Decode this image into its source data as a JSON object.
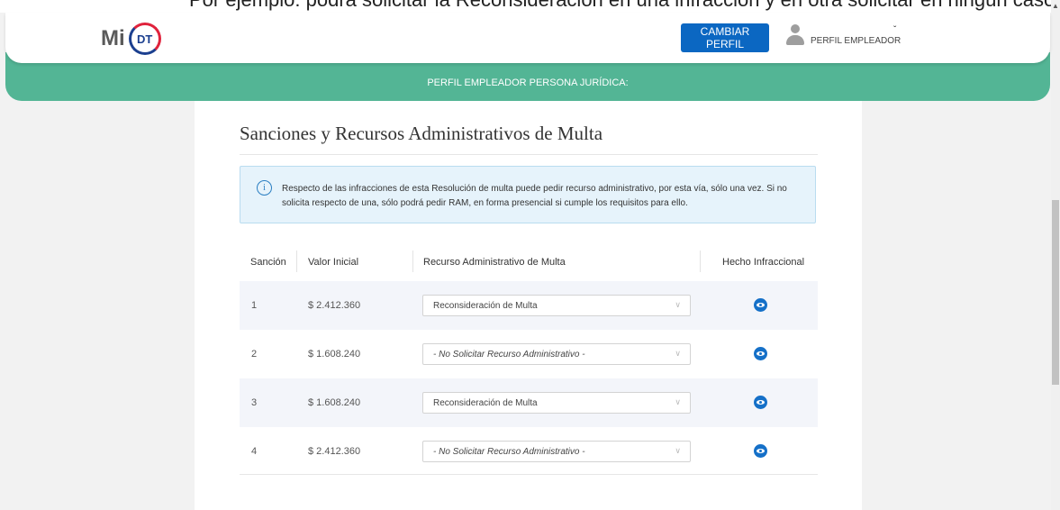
{
  "top_cut_text": "Por ejemplo: podrá solicitar la Reconsideración en una infracción y en otra solicitar en ningún caso y luego",
  "header": {
    "logo_mi": "Mi",
    "logo_dt": "DT",
    "change_profile_button": "CAMBIAR PERFIL",
    "user_label": "PERFIL EMPLEADOR",
    "caret": "ˇ"
  },
  "banner": {
    "text": "PERFIL EMPLEADOR PERSONA JURÍDICA:"
  },
  "main": {
    "title": "Sanciones y Recursos Administrativos de Multa",
    "info_icon": "i",
    "info_text": "Respecto de las infracciones de esta Resolución de multa puede pedir recurso administrativo, por esta vía, sólo una vez. Si no solicita respecto de una, sólo podrá pedir RAM, en forma presencial si cumple los requisitos para ello."
  },
  "table": {
    "columns": [
      "Sanción",
      "Valor Inicial",
      "Recurso Administrativo de Multa",
      "Hecho Infraccional"
    ],
    "rows": [
      {
        "sancion": "1",
        "valor": "$ 2.412.360",
        "recurso": "Reconsideración de Multa",
        "icon": "eye-icon"
      },
      {
        "sancion": "2",
        "valor": "$ 1.608.240",
        "recurso": "- No Solicitar Recurso Administrativo -",
        "icon": "eye-icon"
      },
      {
        "sancion": "3",
        "valor": "$ 1.608.240",
        "recurso": "Reconsideración de Multa",
        "icon": "eye-icon"
      },
      {
        "sancion": "4",
        "valor": "$ 2.412.360",
        "recurso": "- No Solicitar Recurso Administrativo -",
        "icon": "eye-icon"
      }
    ],
    "chevron": "∨"
  },
  "colors": {
    "green": "#53b595",
    "button_blue": "#0b67c2",
    "eye_blue": "#1570c8"
  }
}
